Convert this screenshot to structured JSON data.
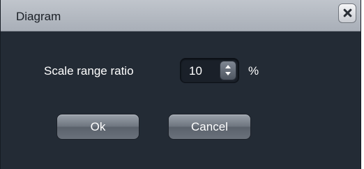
{
  "dialog": {
    "title": "Diagram",
    "close_icon": "close-icon"
  },
  "form": {
    "scale_label": "Scale range ratio",
    "scale_value": "10",
    "unit": "%"
  },
  "buttons": {
    "ok_label": "Ok",
    "cancel_label": "Cancel"
  },
  "colors": {
    "background": "#232b35",
    "titlebar": "#b4bac2",
    "text": "#ffffff"
  }
}
